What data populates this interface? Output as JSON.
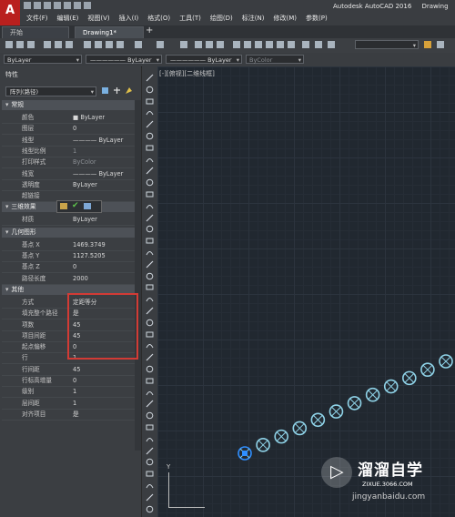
{
  "app": {
    "logo": "A",
    "title": "Autodesk AutoCAD 2016",
    "title_suffix": "Drawing",
    "menus": [
      "文件(F)",
      "编辑(E)",
      "视图(V)",
      "插入(I)",
      "格式(O)",
      "工具(T)",
      "绘图(D)",
      "标注(N)",
      "修改(M)",
      "参数(P)"
    ]
  },
  "tabs": {
    "start": "开始",
    "drawing": "Drawing1*",
    "add": "+"
  },
  "toolbar": {
    "layer": "ByLayer",
    "linetype": "ByLayer",
    "lineweight": "ByLayer",
    "plotstyle": "ByColor"
  },
  "palette": {
    "title": "特性",
    "object_type": "阵列(路径)",
    "sections": {
      "general": "常规",
      "3d": "三维效果",
      "geometry": "几何图形",
      "misc": "其他"
    },
    "general_rows": [
      {
        "key": "颜色",
        "value": "■ ByLayer"
      },
      {
        "key": "图层",
        "value": "0"
      },
      {
        "key": "线型",
        "value": "———— ByLayer"
      },
      {
        "key": "线型比例",
        "value": "1"
      },
      {
        "key": "打印样式",
        "value": "ByColor"
      },
      {
        "key": "线宽",
        "value": "———— ByLayer"
      },
      {
        "key": "透明度",
        "value": "ByLayer"
      },
      {
        "key": "超链接",
        "value": ""
      }
    ],
    "three_d_rows": [
      {
        "key": "材质",
        "value": "ByLayer"
      }
    ],
    "geometry_rows": [
      {
        "key": "基点 X",
        "value": "1469.3749"
      },
      {
        "key": "基点 Y",
        "value": "1127.5205"
      },
      {
        "key": "基点 Z",
        "value": "0"
      },
      {
        "key": "路径长度",
        "value": "2000"
      }
    ],
    "misc_rows": [
      {
        "key": "方式",
        "value": "定距等分"
      },
      {
        "key": "填充整个路径",
        "value": "是"
      },
      {
        "key": "项数",
        "value": "45"
      },
      {
        "key": "项目间距",
        "value": "45"
      },
      {
        "key": "起点偏移",
        "value": "0"
      },
      {
        "key": "行",
        "value": "1"
      },
      {
        "key": "行间距",
        "value": "45"
      },
      {
        "key": "行标高增量",
        "value": "0"
      },
      {
        "key": "级别",
        "value": "1"
      },
      {
        "key": "层间距",
        "value": "1"
      },
      {
        "key": "对齐项目",
        "value": "是"
      }
    ]
  },
  "canvas": {
    "view_label": "[-][俯视][二维线框]",
    "ucs_y": "Y",
    "circle_color": "#8fd3e8",
    "selected_color": "#2f8fff",
    "circles": 12
  },
  "watermark": {
    "name": "溜溜自学",
    "url": "ZIXUE.3066.COM",
    "url2": "jingyanbaidu.com"
  },
  "colors": {
    "highlight_box": "#d23b35",
    "canvas_bg": "#212830"
  }
}
